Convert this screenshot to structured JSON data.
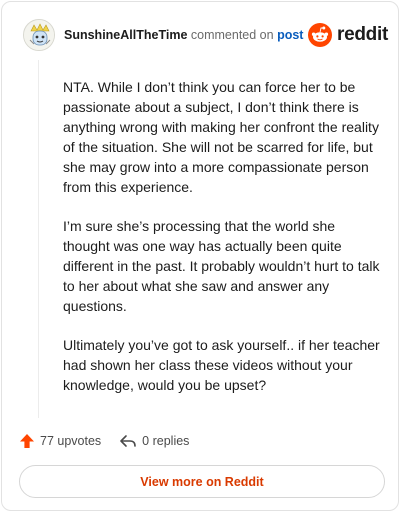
{
  "comment": {
    "username": "SunshineAllTheTime",
    "action_text": "commented on",
    "post_link": "post",
    "paragraphs": [
      "NTA. While I don’t think you can force her to be passionate about a subject, I don’t think there is anything wrong with making her confront the reality of the situation. She will not be scarred for life, but she may grow into a more compassionate person from this experience.",
      "I’m sure she’s processing that the world she thought was one way has actually been quite different in the past. It probably wouldn’t hurt to talk to her about what she saw and answer any questions.",
      "Ultimately you’ve got to ask yourself.. if her teacher had shown her class these videos without your knowledge, would you be upset?"
    ]
  },
  "brand": {
    "logo_text": "reddit",
    "icon": "reddit-alien-icon",
    "color": "#ff4500"
  },
  "actions": {
    "upvotes": "77 upvotes",
    "replies": "0 replies",
    "upvote_icon": "upvote-arrow-icon",
    "reply_icon": "reply-arrow-icon",
    "upvote_color": "#ff4500"
  },
  "footer": {
    "view_more_label": "View more on Reddit",
    "link_color": "#d93a00"
  }
}
